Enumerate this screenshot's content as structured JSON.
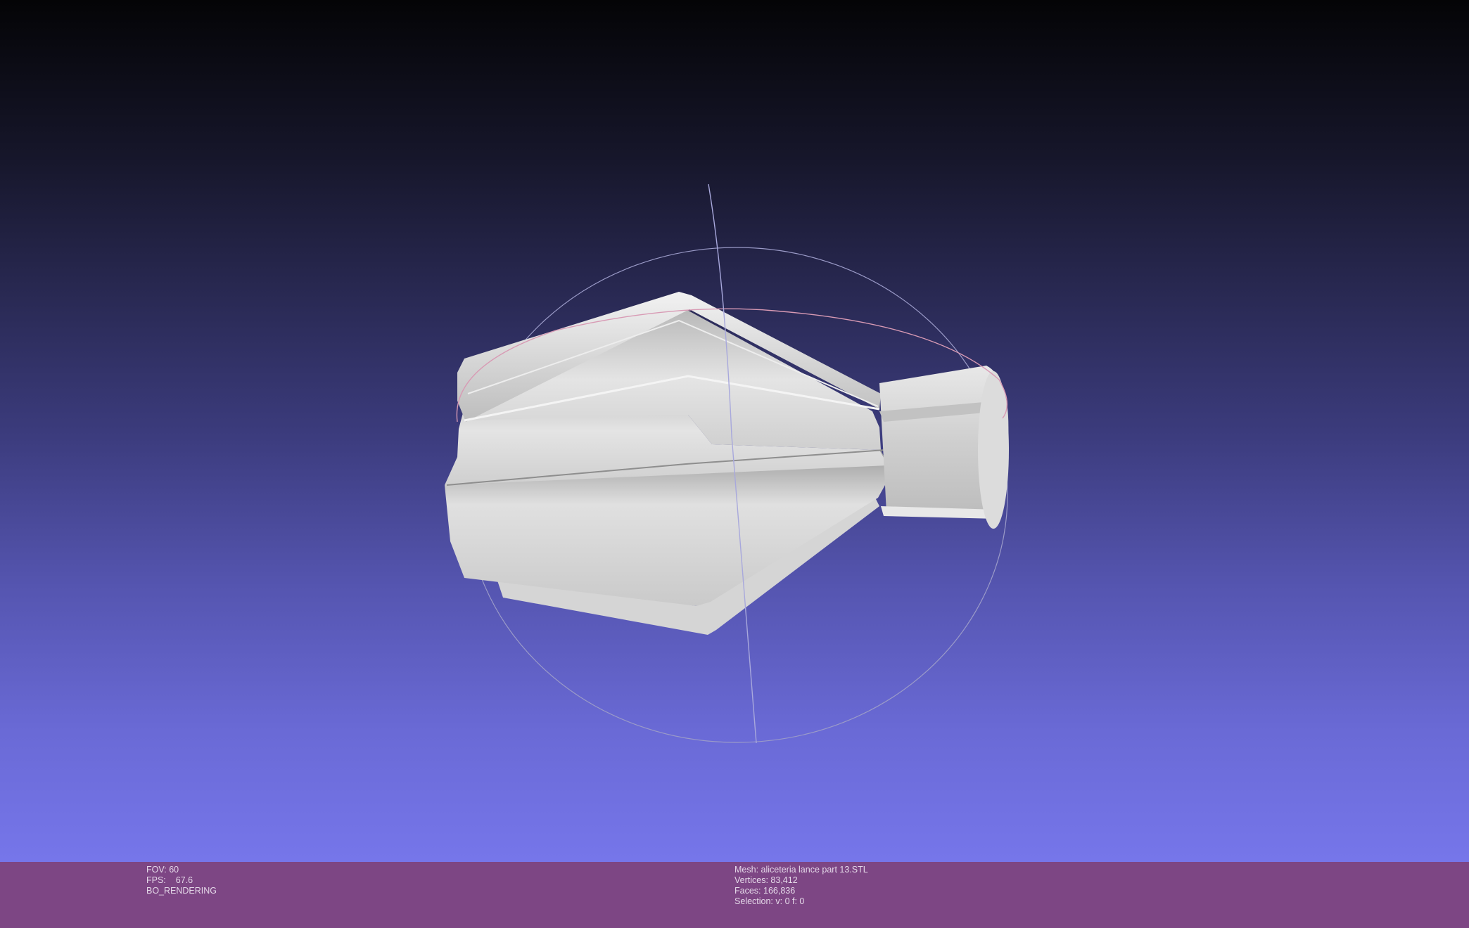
{
  "status": {
    "fov_label": "FOV:",
    "fov_value": "60",
    "fps_label": "FPS:",
    "fps_value": "67.6",
    "render_mode": "BO_RENDERING",
    "mesh_label": "Mesh:",
    "mesh_name": "aliceteria lance part 13.STL",
    "vertices_label": "Vertices:",
    "vertices_value": "83,412",
    "faces_label": "Faces:",
    "faces_value": "166,836",
    "selection_label": "Selection:",
    "selection_value": "v: 0 f: 0"
  },
  "colors": {
    "status_bar": "#7d4684",
    "model": "#d8d8d8",
    "trackball_horizontal": "#d89ab4",
    "trackball_vertical": "#a8a8dc"
  }
}
